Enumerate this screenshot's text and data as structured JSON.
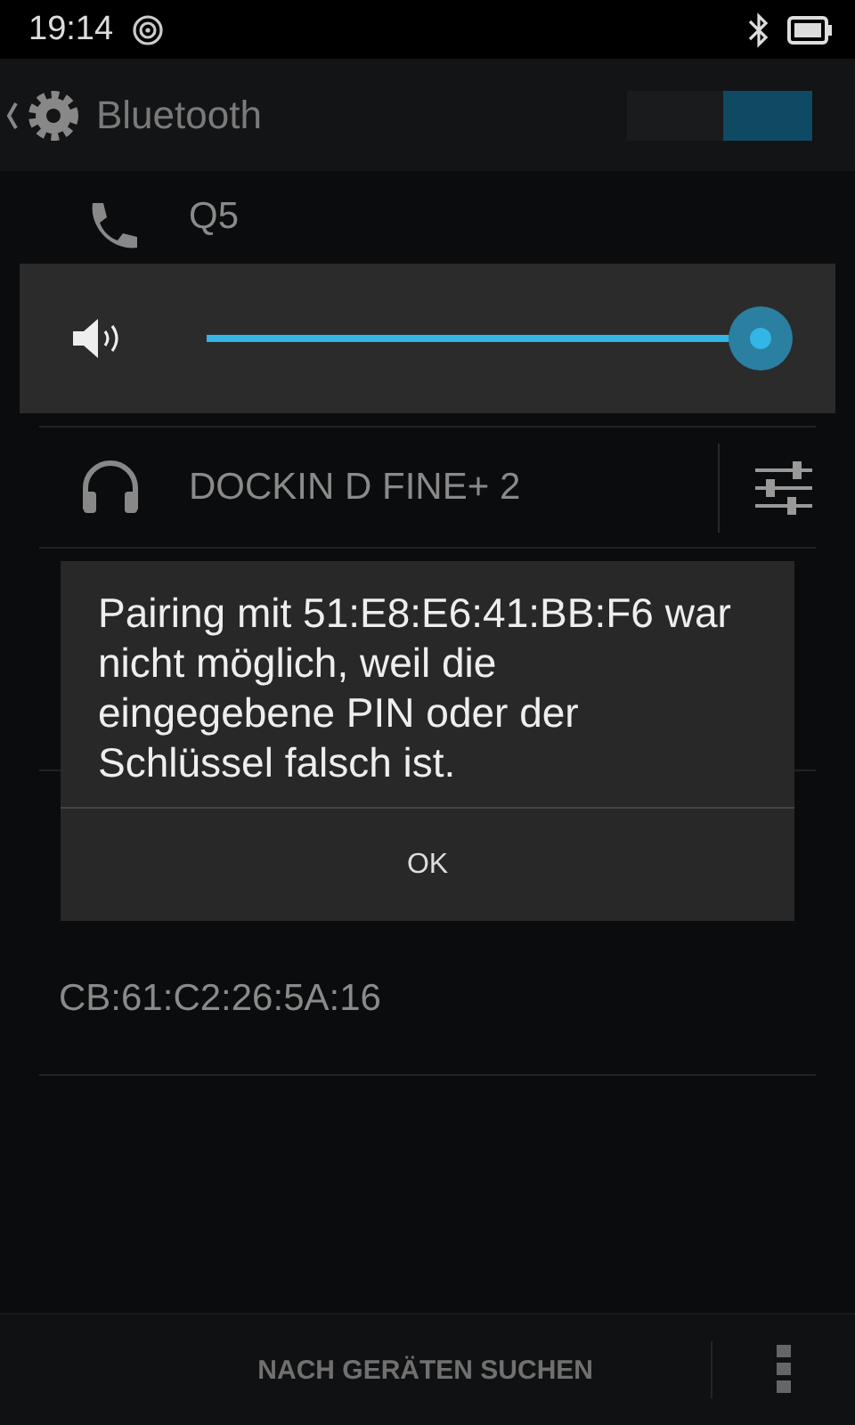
{
  "status_bar": {
    "time": "19:14"
  },
  "action_bar": {
    "title": "Bluetooth",
    "bluetooth_switch": {
      "on": true
    }
  },
  "devices": [
    {
      "name": "Q5",
      "kind": "phone",
      "settings": false
    },
    {
      "name": "DOCKIN D FINE+ 2",
      "kind": "headphones",
      "settings": true
    },
    {
      "name": "CB:61:C2:26:5A:16",
      "kind": "plain",
      "settings": false
    }
  ],
  "volume_panel": {
    "level": 1
  },
  "dialog": {
    "message": "Pairing mit 51:E8:E6:41:BB:F6 war nicht möglich, weil die eingegebene PIN oder der Schlüssel falsch ist.",
    "button": "OK"
  },
  "bottom_bar": {
    "action": "NACH GERÄTEN SUCHEN"
  }
}
